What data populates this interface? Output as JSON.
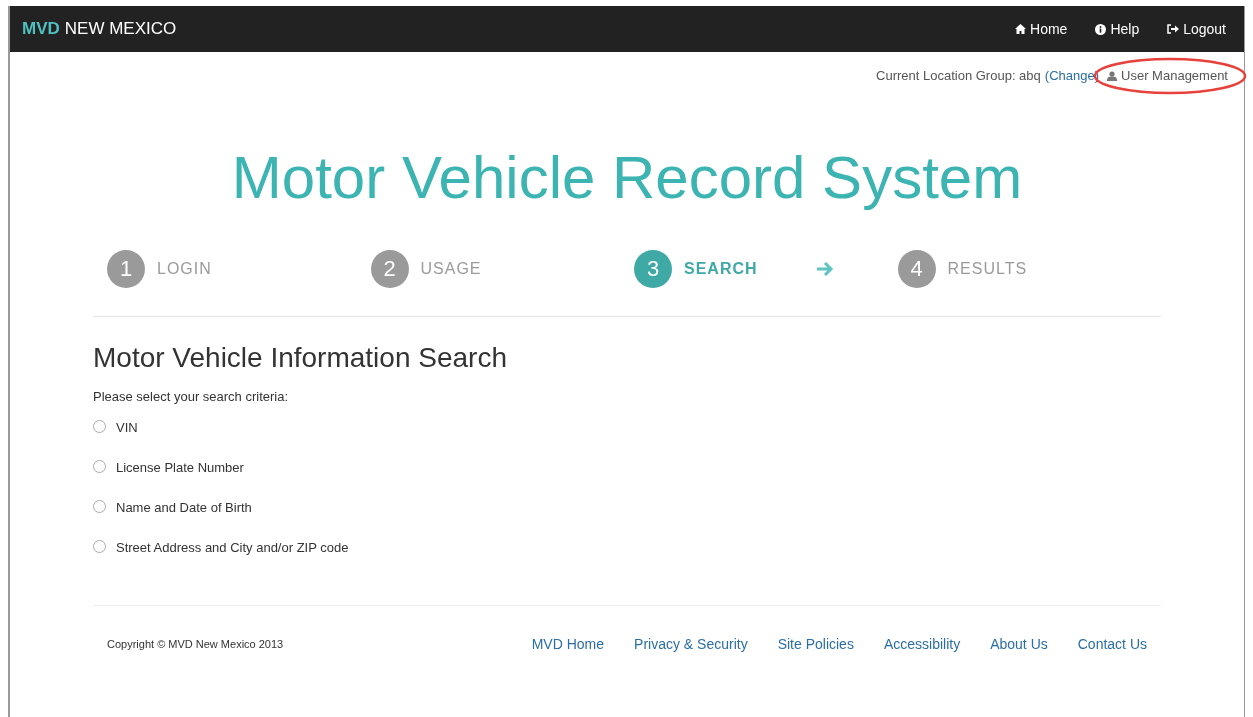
{
  "navbar": {
    "brand_bold": "MVD",
    "brand": "NEW MEXICO",
    "links": [
      {
        "kind": "home",
        "label": "Home"
      },
      {
        "kind": "help",
        "label": "Help"
      },
      {
        "kind": "logout",
        "label": "Logout"
      }
    ]
  },
  "location": {
    "label": "Current Location Group: abq",
    "link_open": "(",
    "link": "Change",
    "link_close": ")",
    "user_management": "User Management",
    "circled": true
  },
  "title": "Motor Vehicle Record System",
  "steps": [
    {
      "number": "1",
      "label": "LOGIN",
      "selected": false
    },
    {
      "number": "2",
      "label": "USAGE",
      "selected": false
    },
    {
      "number": "3",
      "label": "SEARCH",
      "selected": true
    },
    {
      "number": "4",
      "label": "RESULTS",
      "selected": false
    }
  ],
  "search": {
    "heading": "Motor Vehicle Information Search",
    "prompt": "Please select your search criteria:",
    "options": [
      {
        "label": "VIN",
        "selected": false
      },
      {
        "label": "License Plate Number",
        "selected": false
      },
      {
        "label": "Name and Date of Birth",
        "selected": false
      },
      {
        "label": "Street Address and City and/or ZIP code",
        "selected": false
      }
    ]
  },
  "footer": {
    "copyright": "Copyright © MVD New Mexico 2013",
    "links": [
      "MVD Home",
      "Privacy & Security",
      "Site Policies",
      "Accessibility",
      "About Us",
      "Contact Us"
    ]
  }
}
